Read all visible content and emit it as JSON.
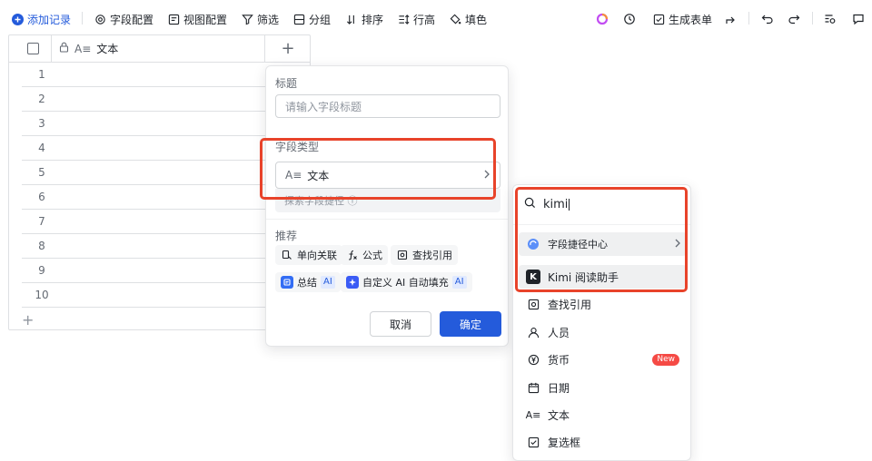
{
  "toolbar": {
    "add_record": "添加记录",
    "field_config": "字段配置",
    "view_config": "视图配置",
    "filter": "筛选",
    "group": "分组",
    "sort": "排序",
    "row_height": "行高",
    "fill_color": "填色",
    "generate_form": "生成表单"
  },
  "grid": {
    "column_header": "文本",
    "rows": [
      "1",
      "2",
      "3",
      "4",
      "5",
      "6",
      "7",
      "8",
      "9",
      "10"
    ],
    "add_row_symbol": "+",
    "add_column_symbol": "+"
  },
  "field_panel": {
    "title_label": "标题",
    "title_placeholder": "请输入字段标题",
    "type_label": "字段类型",
    "type_value": "文本",
    "type_prefix": "A≡",
    "search_hint": "探索字段捷径 ⓘ",
    "recommend_label": "推荐",
    "chips": [
      {
        "label": "单向关联",
        "icon": "one-way-link-icon"
      },
      {
        "label": "公式",
        "icon": "formula-icon"
      },
      {
        "label": "查找引用",
        "icon": "lookup-icon"
      },
      {
        "label": "总结",
        "icon": "summary-ai-icon",
        "tag": "AI"
      },
      {
        "label": "自定义 AI 自动填充",
        "icon": "custom-ai-icon",
        "tag": "AI"
      }
    ],
    "cancel": "取消",
    "confirm": "确定"
  },
  "type_dropdown": {
    "search_value": "kimi",
    "shortcut_center": "字段捷径中心",
    "items": [
      {
        "label": "Kimi 阅读助手",
        "icon": "kimi-icon"
      },
      {
        "label": "查找引用",
        "icon": "lookup-icon"
      },
      {
        "label": "人员",
        "icon": "person-icon"
      },
      {
        "label": "货币",
        "icon": "currency-icon",
        "badge": "New"
      },
      {
        "label": "日期",
        "icon": "calendar-icon"
      },
      {
        "label": "文本",
        "icon": "text-icon"
      },
      {
        "label": "复选框",
        "icon": "checkbox-icon"
      }
    ]
  },
  "colors": {
    "accent": "#245bdb",
    "highlight": "#e8432a",
    "new_badge": "#f54a45"
  }
}
